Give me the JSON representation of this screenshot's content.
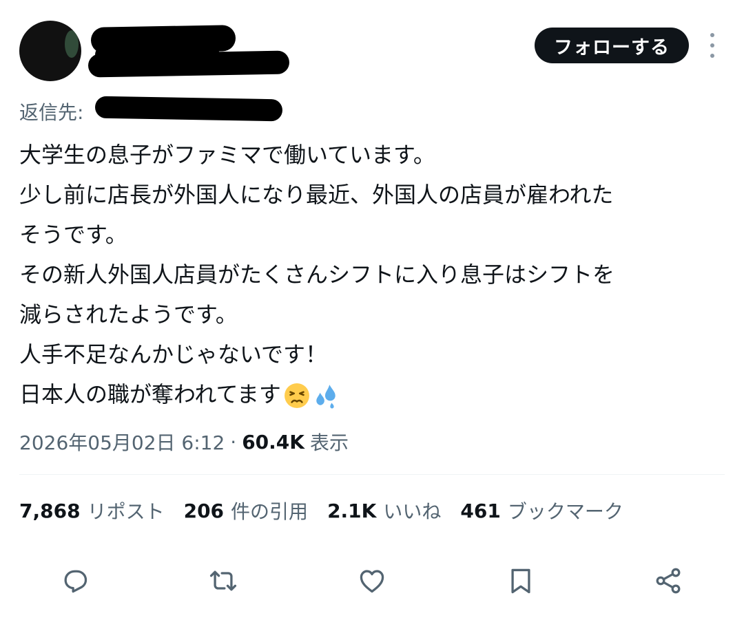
{
  "header": {
    "follow_label": "フォローする"
  },
  "reply": {
    "prefix": "返信先:"
  },
  "tweet": {
    "lines": [
      "大学生の息子がファミマで働いています。",
      "少し前に店長が外国人になり最近、外国人の店員が雇われた",
      "そうです。",
      "その新人外国人店員がたくさんシフトに入り息子はシフトを",
      "減らされたようです。",
      "人手不足なんかじゃないです！",
      "日本人の職が奪われてます"
    ],
    "emojis": [
      "persevering-face-emoji",
      "sweat-droplets-emoji"
    ]
  },
  "meta": {
    "timestamp": "2026年05月02日 6:12",
    "separator": "·",
    "views_count": "60.4K",
    "views_label": "表示"
  },
  "stats": {
    "reposts": {
      "count": "7,868",
      "label": "リポスト"
    },
    "quotes": {
      "count": "206",
      "label": "件の引用"
    },
    "likes": {
      "count": "2.1K",
      "label": "いいね"
    },
    "bookmarks": {
      "count": "461",
      "label": "ブックマーク"
    }
  },
  "actions": {
    "icons": [
      "reply-icon",
      "repost-icon",
      "like-icon",
      "bookmark-icon",
      "share-icon"
    ]
  },
  "colors": {
    "text_primary": "#0f1419",
    "text_secondary": "#536471",
    "icon": "#536471",
    "divider": "#eff3f4",
    "follow_bg": "#0f1419"
  }
}
